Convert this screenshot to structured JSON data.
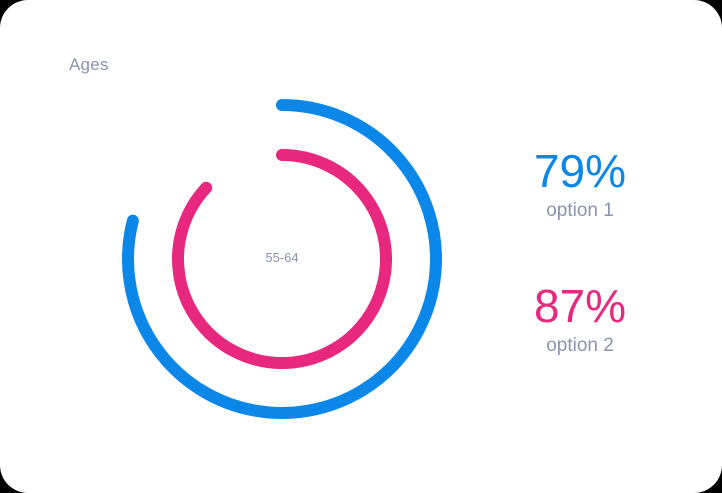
{
  "chart_data": {
    "type": "radial-bar",
    "title": "Ages",
    "center_label": "55-64",
    "series": [
      {
        "name": "option 1",
        "value": 79,
        "value_label": "79%",
        "color": "#0a87e8"
      },
      {
        "name": "option 2",
        "value": 87,
        "value_label": "87%",
        "color": "#e8287f"
      }
    ],
    "max": 100,
    "start_angle": "top",
    "direction": "clockwise"
  }
}
